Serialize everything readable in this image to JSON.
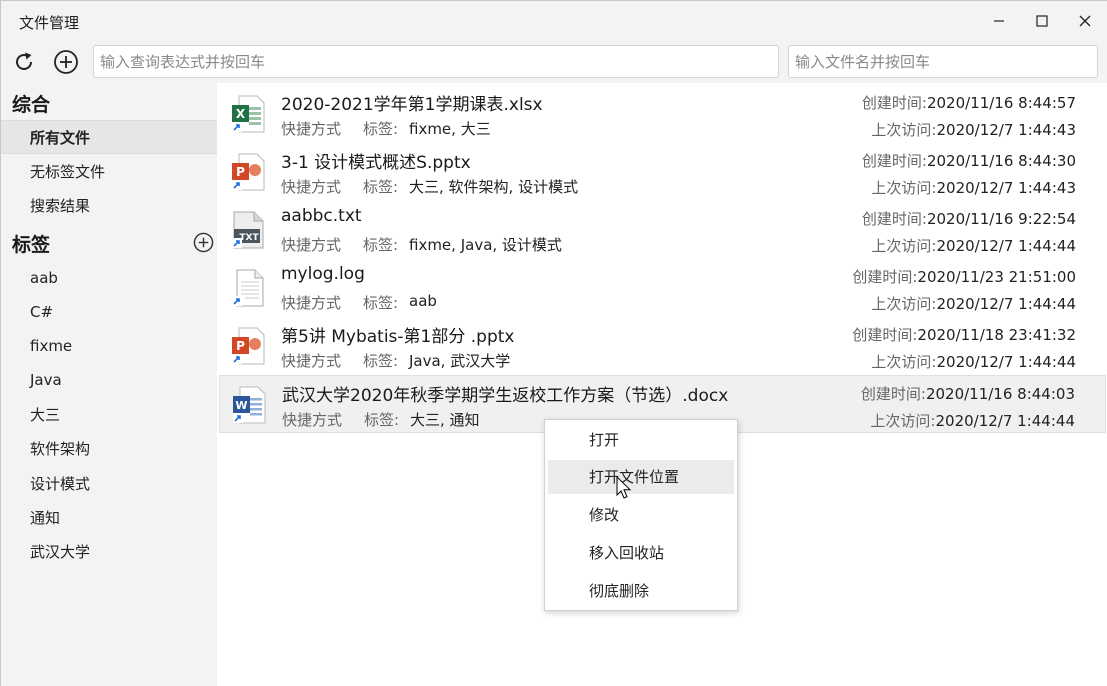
{
  "window": {
    "title": "文件管理"
  },
  "toolbar": {
    "refresh_icon": "refresh-icon",
    "add_icon": "add-icon",
    "query_placeholder": "输入查询表达式并按回车",
    "query_value": "",
    "name_placeholder": "输入文件名并按回车",
    "name_value": ""
  },
  "sidebar": {
    "general_title": "综合",
    "general_items": [
      {
        "label": "所有文件",
        "selected": true
      },
      {
        "label": "无标签文件",
        "selected": false
      },
      {
        "label": "搜索结果",
        "selected": false
      }
    ],
    "tags_title": "标签",
    "tags": [
      "aab",
      "C#",
      "fixme",
      "Java",
      "大三",
      "软件架构",
      "设计模式",
      "通知",
      "武汉大学"
    ]
  },
  "files": [
    {
      "name": "2020-2021学年第1学期课表.xlsx",
      "type": "快捷方式",
      "tag_label": "标签:",
      "tags": "fixme, 大三",
      "created_label": "创建时间:",
      "created": "2020/11/16 8:44:57",
      "accessed_label": "上次访问:",
      "accessed": "2020/12/7 1:44:43",
      "icon": "excel-icon"
    },
    {
      "name": "3-1 设计模式概述S.pptx",
      "type": "快捷方式",
      "tag_label": "标签:",
      "tags": "大三, 软件架构, 设计模式",
      "created_label": "创建时间:",
      "created": "2020/11/16 8:44:30",
      "accessed_label": "上次访问:",
      "accessed": "2020/12/7 1:44:43",
      "icon": "powerpoint-icon"
    },
    {
      "name": "aabbc.txt",
      "type": "快捷方式",
      "tag_label": "标签:",
      "tags": "fixme, Java, 设计模式",
      "created_label": "创建时间:",
      "created": "2020/11/16 9:22:54",
      "accessed_label": "上次访问:",
      "accessed": "2020/12/7 1:44:44",
      "icon": "text-file-icon"
    },
    {
      "name": "mylog.log",
      "type": "快捷方式",
      "tag_label": "标签:",
      "tags": "aab",
      "created_label": "创建时间:",
      "created": "2020/11/23 21:51:00",
      "accessed_label": "上次访问:",
      "accessed": "2020/12/7 1:44:44",
      "icon": "document-icon"
    },
    {
      "name": "第5讲 Mybatis-第1部分 .pptx",
      "type": "快捷方式",
      "tag_label": "标签:",
      "tags": "Java, 武汉大学",
      "created_label": "创建时间:",
      "created": "2020/11/18 23:41:32",
      "accessed_label": "上次访问:",
      "accessed": "2020/12/7 1:44:44",
      "icon": "powerpoint-icon"
    },
    {
      "name": "武汉大学2020年秋季学期学生返校工作方案（节选）.docx",
      "type": "快捷方式",
      "tag_label": "标签:",
      "tags": "大三, 通知",
      "created_label": "创建时间:",
      "created": "2020/11/16 8:44:03",
      "accessed_label": "上次访问:",
      "accessed": "2020/12/7 1:44:44",
      "icon": "word-icon",
      "selected": true
    }
  ],
  "context_menu": {
    "items": [
      {
        "label": "打开",
        "hover": false
      },
      {
        "label": "打开文件位置",
        "hover": true
      },
      {
        "label": "修改",
        "hover": false
      },
      {
        "label": "移入回收站",
        "hover": false
      },
      {
        "label": "彻底删除",
        "hover": false
      }
    ]
  },
  "colors": {
    "excel": "#1f7244",
    "powerpoint": "#d24726",
    "word": "#2b579a",
    "shortcut_arrow": "#1e6fd9"
  }
}
